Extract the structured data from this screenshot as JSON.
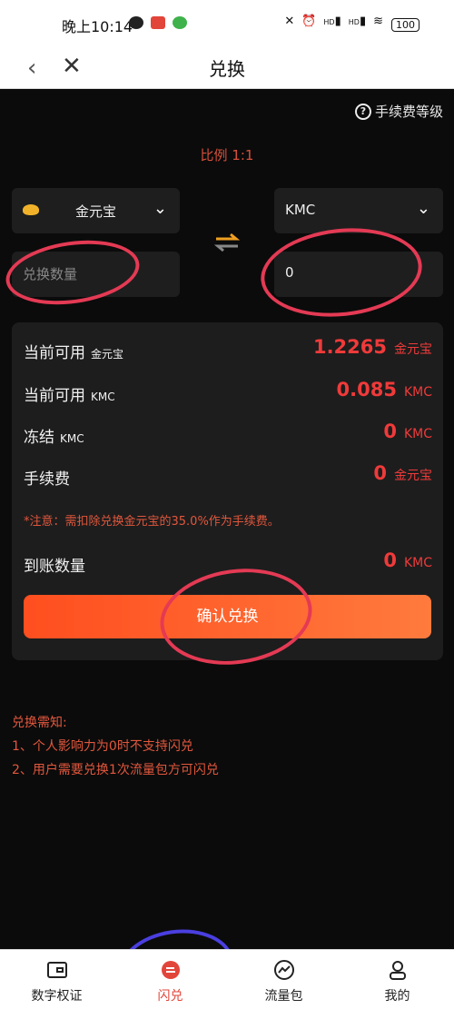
{
  "statusbar": {
    "time": "晚上10:14",
    "battery": "100",
    "hd1": "HD",
    "hd2": "HD"
  },
  "header": {
    "title": "兑换"
  },
  "fee_level": {
    "label": "手续费等级"
  },
  "ratio": "比例 1:1",
  "from_select": {
    "label": "金元宝"
  },
  "to_select": {
    "label": "KMC"
  },
  "inputs": {
    "from_placeholder": "兑换数量",
    "to_value": "0"
  },
  "card": {
    "rows": [
      {
        "label": "当前可用",
        "sub": "金元宝",
        "value": "1.2265",
        "unit": "金元宝"
      },
      {
        "label": "当前可用",
        "sub": "KMC",
        "value": "0.085",
        "unit": "KMC"
      },
      {
        "label": "冻结",
        "sub": "KMC",
        "value": "0",
        "unit": "KMC"
      },
      {
        "label": "手续费",
        "sub": "",
        "value": "0",
        "unit": "金元宝"
      }
    ],
    "note": "*注意：需扣除兑换金元宝的35.0%作为手续费。",
    "arrival": {
      "label": "到账数量",
      "value": "0",
      "unit": "KMC"
    },
    "confirm_label": "确认兑换"
  },
  "notice": {
    "title": "兑换需知:",
    "line1": "1、个人影响力为0时不支持闪兑",
    "line2": "2、用户需要兑换1次流量包方可闪兑"
  },
  "nav": {
    "items": [
      {
        "label": "数字权证",
        "icon": "wallet-icon"
      },
      {
        "label": "闪兑",
        "icon": "exchange-icon"
      },
      {
        "label": "流量包",
        "icon": "chart-icon"
      },
      {
        "label": "我的",
        "icon": "user-icon"
      }
    ]
  },
  "colors": {
    "accent": "#f03a3a",
    "annotation": "#e43a54",
    "nav_annotation": "#4a3fe0"
  }
}
